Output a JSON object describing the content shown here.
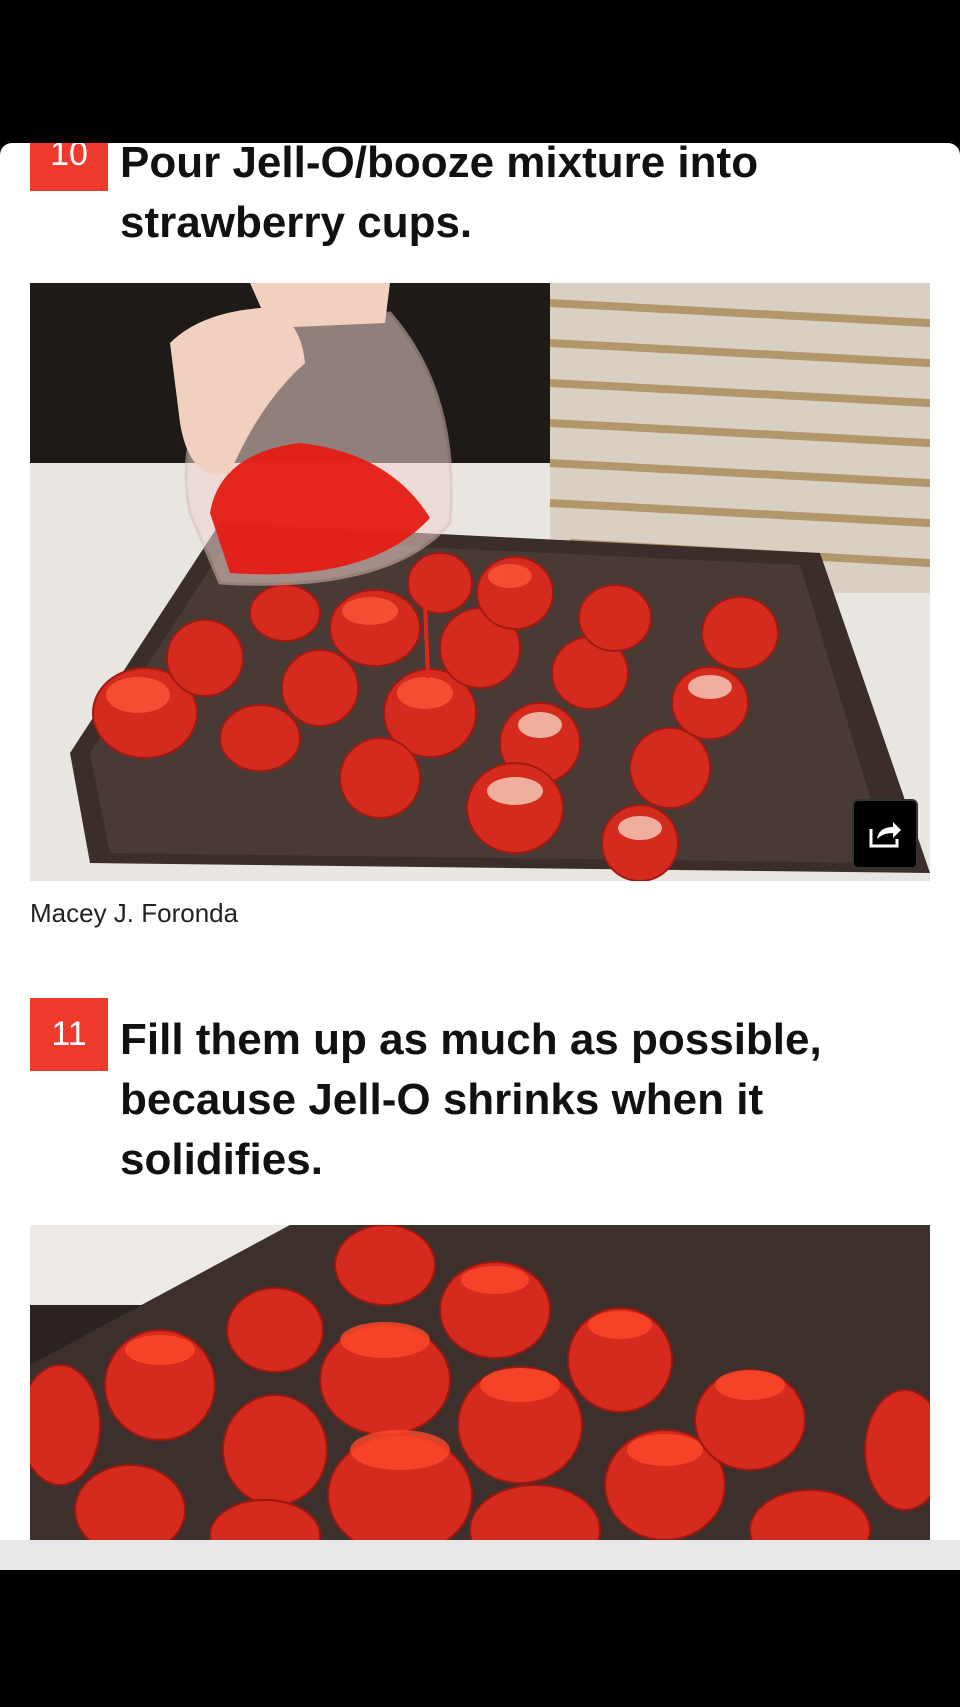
{
  "steps": [
    {
      "number": "10",
      "title": "Pour Jell-O/booze mixture into strawberry cups."
    },
    {
      "number": "11",
      "title": "Fill them up as much as possible, because Jell-O shrinks when it solidifies."
    }
  ],
  "photo_credit": "Macey J. Foronda",
  "icons": {
    "share": "share-icon"
  },
  "colors": {
    "step_badge": "#ee3a2c",
    "strawberry": "#d42b1e",
    "tray": "#3b2e2a"
  }
}
